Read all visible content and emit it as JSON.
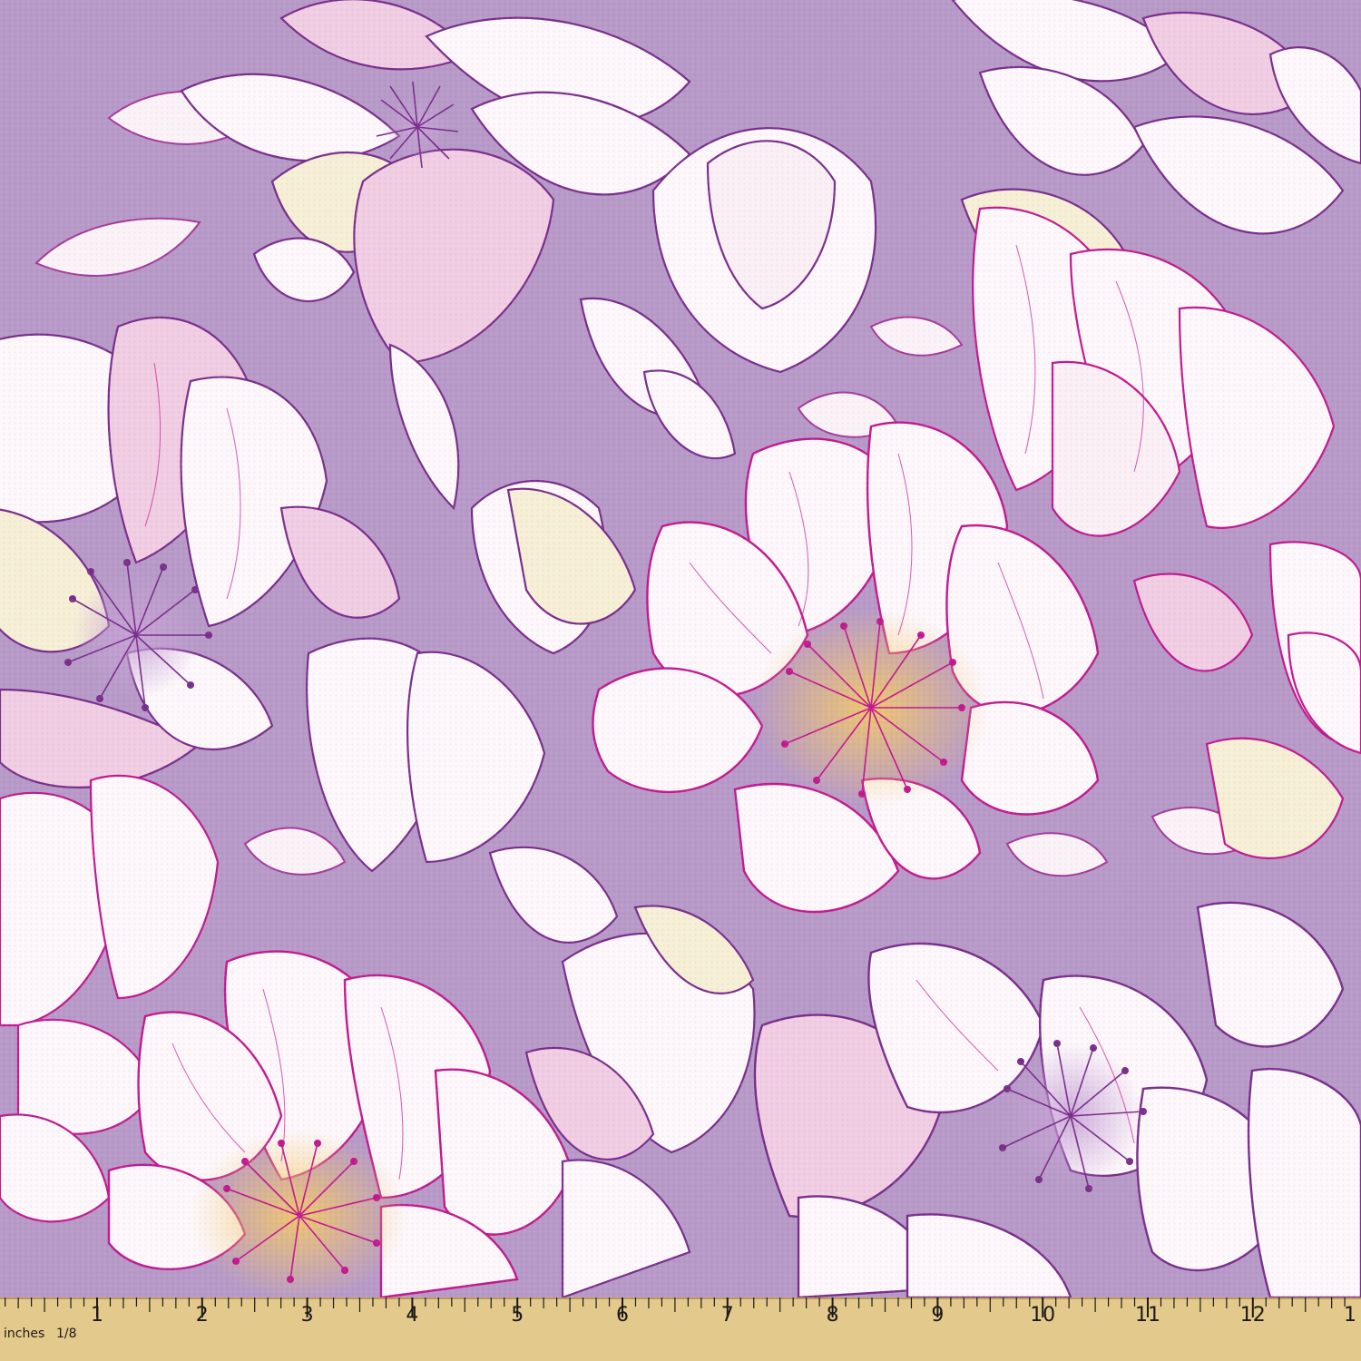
{
  "colors": {
    "background": "#b79ac8",
    "petal": "#fdf7fb",
    "petal_pink": "#f1cde3",
    "petal_cream": "#f6efd6",
    "outline_magenta": "#c21a8f",
    "outline_purple": "#7a2f8c",
    "stamen_yellow": "#f2c86b",
    "ruler_wood": "#e3c98c"
  },
  "ruler": {
    "unit_label": "inches",
    "fraction_label": "1/8",
    "numbers": [
      "1",
      "2",
      "3",
      "4",
      "5",
      "6",
      "7",
      "8",
      "9",
      "10",
      "11",
      "12",
      "1"
    ]
  }
}
